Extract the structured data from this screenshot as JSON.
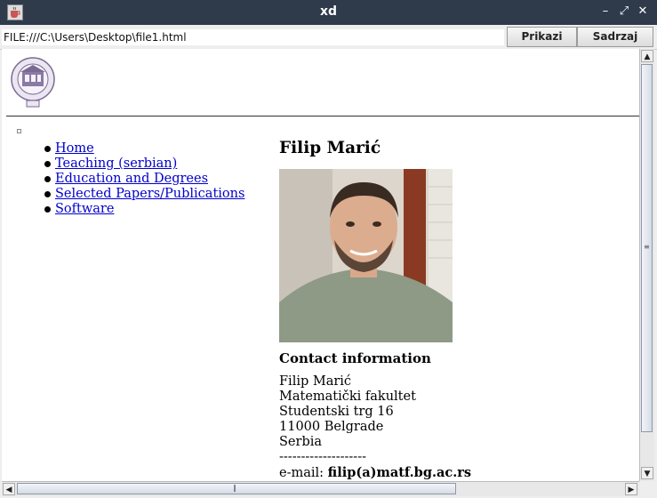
{
  "window": {
    "title": "xd",
    "buttons": {
      "minimize": "–",
      "restore": "⤢",
      "close": "✕"
    }
  },
  "toolbar": {
    "url_value": "FILE:///C:\\Users\\Desktop\\file1.html",
    "show_label": "Prikazi",
    "contents_label": "Sadrzaj"
  },
  "nav": {
    "items": [
      {
        "label": "Home"
      },
      {
        "label": "Teaching (serbian)"
      },
      {
        "label": "Education and Degrees"
      },
      {
        "label": "Selected Papers/Publications"
      },
      {
        "label": "Software"
      }
    ]
  },
  "profile": {
    "name": "Filip Marić",
    "contact_heading": "Contact information",
    "address": [
      "Filip Marić",
      "Matematički fakultet",
      "Studentski trg 16",
      "11000 Belgrade",
      "Serbia"
    ],
    "separator": "--------------------",
    "email_label": "e-mail:",
    "email_value": "filip(a)matf.bg.ac.rs"
  },
  "colors": {
    "titlebar": "#2f3a4b",
    "link": "#0000cc"
  },
  "icons": {
    "app": "java-cup-icon",
    "scroll_up": "arrow-up-icon",
    "scroll_down": "arrow-down-icon",
    "scroll_left": "arrow-left-icon",
    "scroll_right": "arrow-right-icon"
  }
}
